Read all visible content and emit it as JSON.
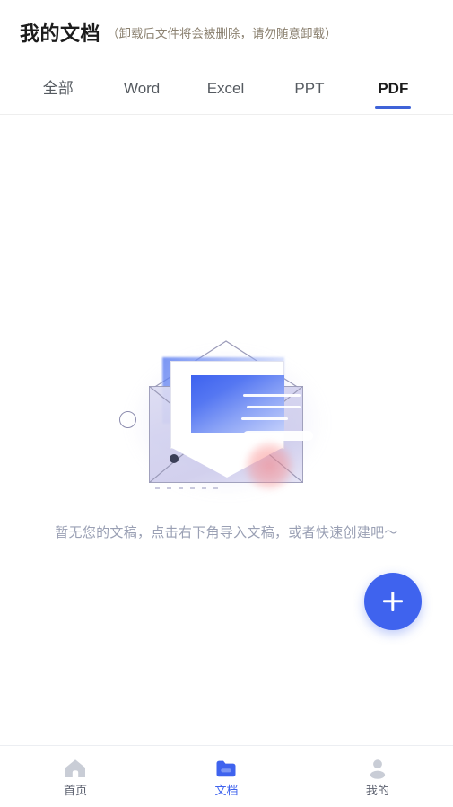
{
  "header": {
    "title": "我的文档",
    "note": "（卸载后文件将会被删除，请勿随意卸载）"
  },
  "tabs": [
    {
      "label": "全部",
      "active": false
    },
    {
      "label": "Word",
      "active": false
    },
    {
      "label": "Excel",
      "active": false
    },
    {
      "label": "PPT",
      "active": false
    },
    {
      "label": "PDF",
      "active": true
    }
  ],
  "empty_state": {
    "message": "暂无您的文稿，点击右下角导入文稿，或者快速创建吧～",
    "illustration": "empty-envelope-document-illustration"
  },
  "fab": {
    "icon": "plus-icon",
    "label": "+"
  },
  "bottom_nav": [
    {
      "label": "首页",
      "icon": "home-icon",
      "active": false
    },
    {
      "label": "文档",
      "icon": "folder-icon",
      "active": true
    },
    {
      "label": "我的",
      "icon": "person-icon",
      "active": false
    }
  ],
  "colors": {
    "accent": "#3f63ee",
    "tab_underline": "#3f63d8",
    "title": "#1c1c1c",
    "note": "#8b8170",
    "tab_inactive": "#555a60",
    "empty_text": "#9aa0b4",
    "nav_inactive": "#5d6270",
    "nav_icon_inactive": "#c9cdd6"
  }
}
